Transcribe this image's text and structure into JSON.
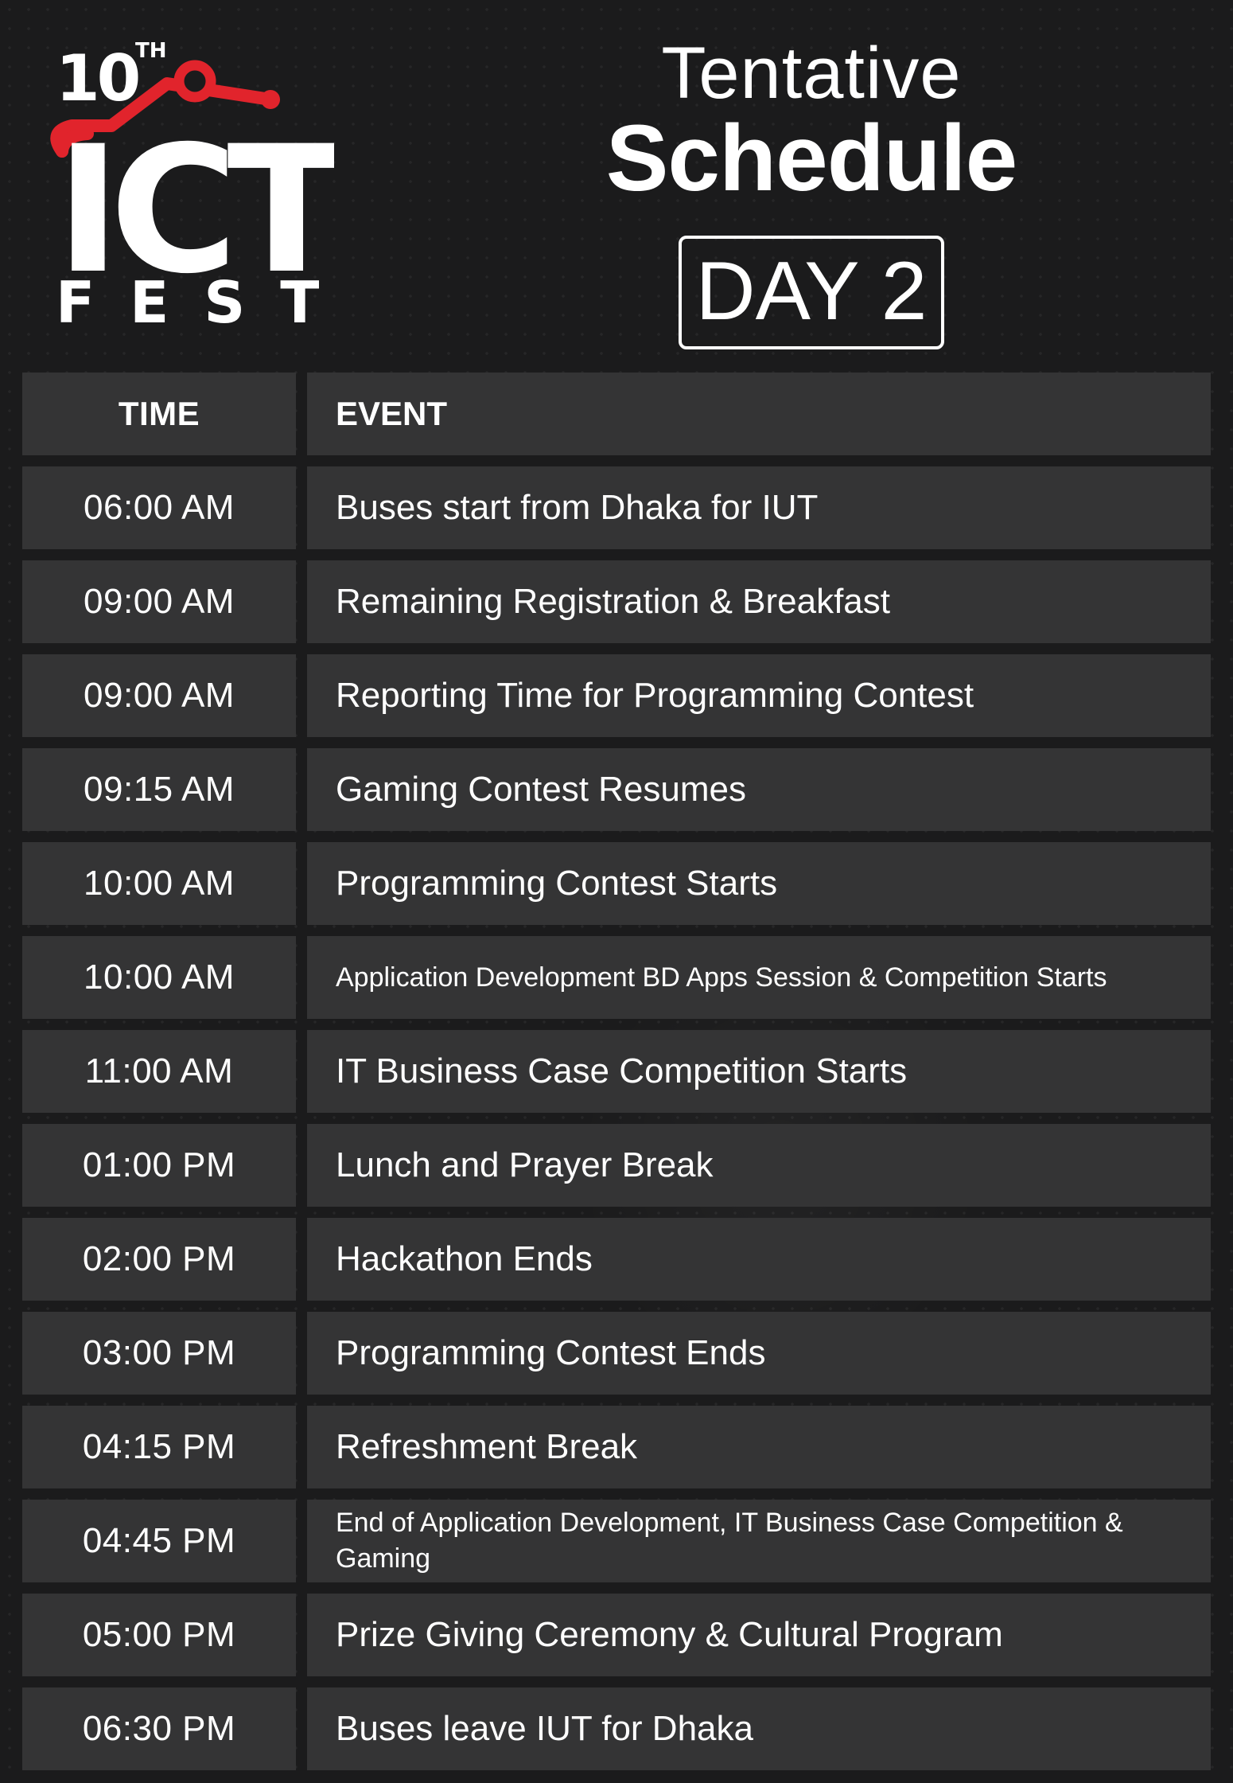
{
  "logo": {
    "edition": "10",
    "edition_suffix": "TH",
    "name": "ICT",
    "subtitle": "FEST",
    "accent_color": "#e1242c"
  },
  "title": {
    "line1": "Tentative",
    "line2": "Schedule",
    "day": "DAY 2"
  },
  "table": {
    "headers": {
      "time": "TIME",
      "event": "EVENT"
    },
    "rows": [
      {
        "time": "06:00 AM",
        "event": "Buses start from Dhaka for IUT"
      },
      {
        "time": "09:00 AM",
        "event": "Remaining Registration & Breakfast"
      },
      {
        "time": "09:00 AM",
        "event": "Reporting Time for Programming Contest"
      },
      {
        "time": "09:15 AM",
        "event": "Gaming Contest Resumes"
      },
      {
        "time": "10:00 AM",
        "event": "Programming Contest Starts"
      },
      {
        "time": "10:00 AM",
        "event": "Application Development BD Apps Session & Competition Starts"
      },
      {
        "time": "11:00 AM",
        "event": "IT Business Case Competition Starts"
      },
      {
        "time": "01:00 PM",
        "event": "Lunch and Prayer Break"
      },
      {
        "time": "02:00 PM",
        "event": "Hackathon Ends"
      },
      {
        "time": "03:00 PM",
        "event": "Programming Contest Ends"
      },
      {
        "time": "04:15 PM",
        "event": "Refreshment Break"
      },
      {
        "time": "04:45 PM",
        "event": "End of Application Development, IT Business Case Competition & Gaming"
      },
      {
        "time": "05:00 PM",
        "event": "Prize Giving Ceremony & Cultural Program"
      },
      {
        "time": "06:30 PM",
        "event": "Buses leave IUT for Dhaka"
      }
    ]
  },
  "colors": {
    "background": "#1b1b1c",
    "cell": "#343435",
    "text": "#ffffff"
  }
}
